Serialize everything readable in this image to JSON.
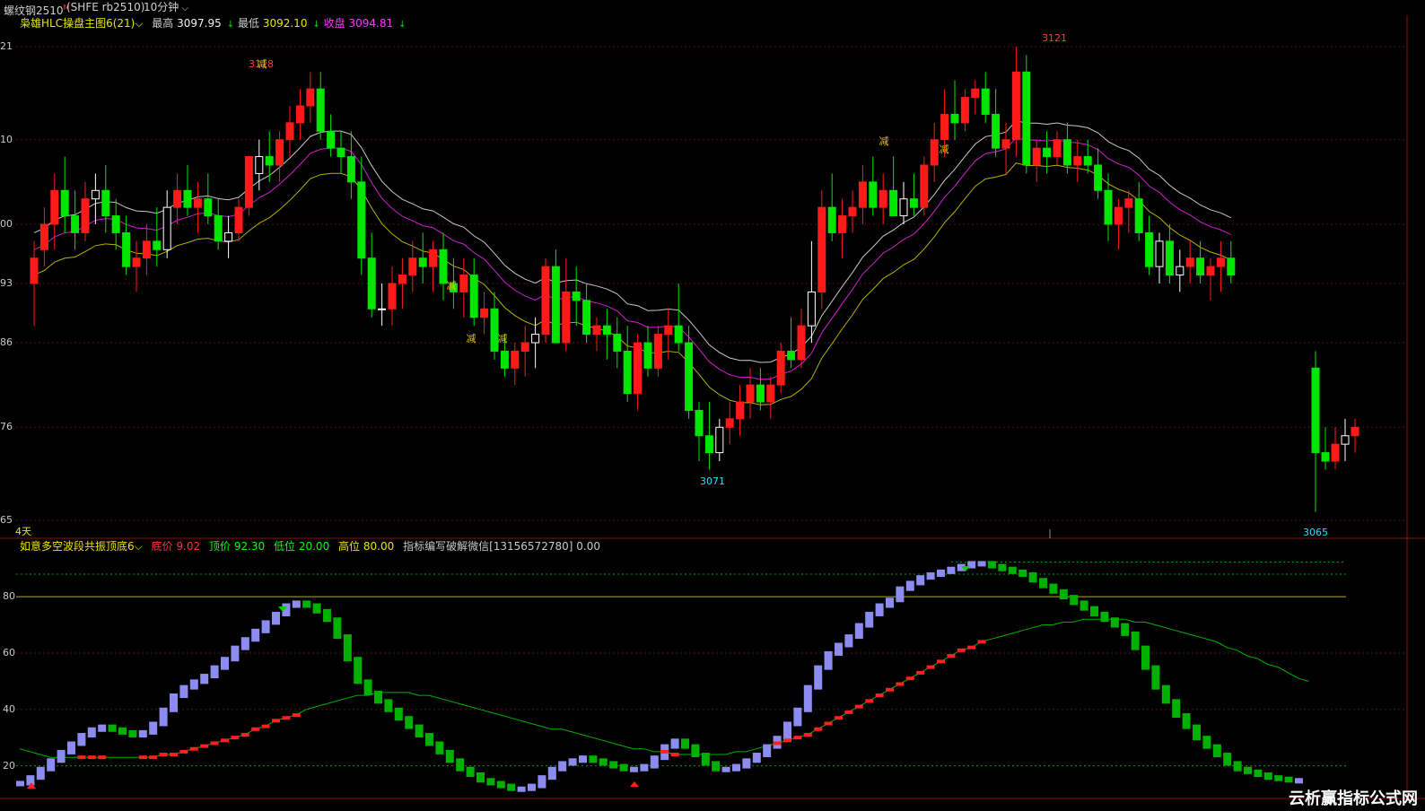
{
  "topbar": {
    "symbol": "螺纹钢2510",
    "symbol_sup": "M",
    "code": "(SHFE  rb2510)",
    "period": "10分钟"
  },
  "main_legend": {
    "indicator": "枭雄HLC操盘主图6(21)",
    "high_label": "最高",
    "high_value": "3097.95",
    "low_label": "最低",
    "low_value": "3092.10",
    "close_label": "收盘",
    "close_value": "3094.81"
  },
  "sub_legend": {
    "indicator": "如意多空波段共振顶底6",
    "bottom_label": "底价",
    "bottom_value": "9.02",
    "top_label": "顶价",
    "top_value": "92.30",
    "low_label": "低位",
    "low_value": "20.00",
    "high_label": "高位",
    "high_value": "80.00",
    "author_text": "指标编写破解微信[13156572780]",
    "author_value": "0.00"
  },
  "main_axis_labels": [
    "21",
    "10",
    "00",
    "93",
    "86",
    "76",
    "65"
  ],
  "sub_axis_labels": [
    "80",
    "60",
    "40",
    "20"
  ],
  "day_marker": "4天",
  "peak_labels": [
    "3118",
    "3121"
  ],
  "trough_labels": [
    "3071",
    "3065"
  ],
  "signal_char": "减",
  "watermark": "云析赢指标公式网",
  "colors": {
    "up": "#ff1a1a",
    "down": "#00e600",
    "doji": "#ffffff",
    "ma_white": "#c8c8c8",
    "ma_magenta": "#d020d0",
    "ma_yellow": "#b8b000",
    "osc_blue": "#8c8cf0",
    "osc_green": "#00b000",
    "osc_red": "#ff2020",
    "grid": "#5a1010"
  },
  "chart_data": [
    {
      "type": "candlestick",
      "title": "螺纹钢2510 10分钟",
      "ylim": [
        3065,
        3121
      ],
      "annotations": {
        "max": 3121,
        "min": 3065,
        "local_high": 3118,
        "local_low": 3071
      },
      "series": [
        {
          "name": "price",
          "values": [
            [
              3093,
              3098,
              3088,
              3096
            ],
            [
              3097,
              3102,
              3095,
              3100
            ],
            [
              3100,
              3106,
              3097,
              3104
            ],
            [
              3104,
              3108,
              3099,
              3101
            ],
            [
              3101,
              3104,
              3097,
              3099
            ],
            [
              3099,
              3105,
              3098,
              3103
            ],
            [
              3103,
              3106,
              3100,
              3104
            ],
            [
              3104,
              3107,
              3099,
              3101
            ],
            [
              3101,
              3103,
              3097,
              3099
            ],
            [
              3099,
              3101,
              3094,
              3095
            ],
            [
              3095,
              3098,
              3092,
              3096
            ],
            [
              3096,
              3100,
              3094,
              3098
            ],
            [
              3098,
              3102,
              3095,
              3097
            ],
            [
              3097,
              3104,
              3096,
              3102
            ],
            [
              3102,
              3106,
              3100,
              3104
            ],
            [
              3104,
              3107,
              3101,
              3102
            ],
            [
              3102,
              3105,
              3099,
              3103
            ],
            [
              3103,
              3106,
              3100,
              3101
            ],
            [
              3101,
              3103,
              3097,
              3098
            ],
            [
              3098,
              3101,
              3096,
              3099
            ],
            [
              3099,
              3103,
              3098,
              3102
            ],
            [
              3102,
              3106,
              3101,
              3108
            ],
            [
              3106,
              3110,
              3104,
              3108
            ],
            [
              3108,
              3111,
              3105,
              3107
            ],
            [
              3107,
              3111,
              3105,
              3110
            ],
            [
              3110,
              3114,
              3108,
              3112
            ],
            [
              3112,
              3116,
              3110,
              3114
            ],
            [
              3114,
              3118,
              3112,
              3116
            ],
            [
              3116,
              3118,
              3110,
              3111
            ],
            [
              3111,
              3113,
              3108,
              3109
            ],
            [
              3109,
              3111,
              3106,
              3108
            ],
            [
              3108,
              3111,
              3103,
              3105
            ],
            [
              3105,
              3108,
              3094,
              3096
            ],
            [
              3096,
              3099,
              3089,
              3090
            ],
            [
              3090,
              3093,
              3088,
              3090
            ],
            [
              3090,
              3095,
              3088,
              3093
            ],
            [
              3093,
              3096,
              3090,
              3094
            ],
            [
              3094,
              3098,
              3092,
              3096
            ],
            [
              3096,
              3099,
              3093,
              3095
            ],
            [
              3095,
              3098,
              3092,
              3097
            ],
            [
              3097,
              3099,
              3091,
              3093
            ],
            [
              3093,
              3096,
              3090,
              3092
            ],
            [
              3092,
              3096,
              3089,
              3094
            ],
            [
              3094,
              3096,
              3088,
              3089
            ],
            [
              3089,
              3092,
              3087,
              3090
            ],
            [
              3090,
              3092,
              3084,
              3085
            ],
            [
              3085,
              3087,
              3082,
              3083
            ],
            [
              3083,
              3086,
              3081,
              3085
            ],
            [
              3085,
              3088,
              3082,
              3086
            ],
            [
              3086,
              3089,
              3083,
              3087
            ],
            [
              3087,
              3096,
              3086,
              3095
            ],
            [
              3095,
              3097,
              3087,
              3086
            ],
            [
              3086,
              3096,
              3085,
              3092
            ],
            [
              3092,
              3095,
              3088,
              3091
            ],
            [
              3091,
              3093,
              3086,
              3087
            ],
            [
              3087,
              3089,
              3085,
              3088
            ],
            [
              3088,
              3090,
              3084,
              3087
            ],
            [
              3087,
              3089,
              3083,
              3085
            ],
            [
              3085,
              3088,
              3079,
              3080
            ],
            [
              3080,
              3087,
              3078,
              3086
            ],
            [
              3086,
              3088,
              3082,
              3083
            ],
            [
              3083,
              3088,
              3082,
              3087
            ],
            [
              3087,
              3090,
              3084,
              3088
            ],
            [
              3088,
              3093,
              3085,
              3086
            ],
            [
              3086,
              3088,
              3077,
              3078
            ],
            [
              3078,
              3079,
              3072,
              3075
            ],
            [
              3075,
              3079,
              3071,
              3073
            ],
            [
              3073,
              3077,
              3072,
              3076
            ],
            [
              3076,
              3079,
              3074,
              3077
            ],
            [
              3077,
              3081,
              3075,
              3079
            ],
            [
              3079,
              3083,
              3077,
              3081
            ],
            [
              3081,
              3083,
              3078,
              3079
            ],
            [
              3079,
              3082,
              3077,
              3081
            ],
            [
              3081,
              3086,
              3080,
              3085
            ],
            [
              3085,
              3089,
              3083,
              3084
            ],
            [
              3084,
              3090,
              3083,
              3088
            ],
            [
              3088,
              3098,
              3086,
              3092
            ],
            [
              3092,
              3104,
              3090,
              3102
            ],
            [
              3102,
              3106,
              3098,
              3099
            ],
            [
              3099,
              3103,
              3096,
              3101
            ],
            [
              3101,
              3104,
              3099,
              3102
            ],
            [
              3102,
              3107,
              3100,
              3105
            ],
            [
              3105,
              3108,
              3101,
              3102
            ],
            [
              3102,
              3106,
              3100,
              3104
            ],
            [
              3104,
              3108,
              3102,
              3101
            ],
            [
              3101,
              3105,
              3100,
              3103
            ],
            [
              3103,
              3106,
              3101,
              3102
            ],
            [
              3102,
              3108,
              3101,
              3107
            ],
            [
              3107,
              3112,
              3105,
              3110
            ],
            [
              3110,
              3116,
              3108,
              3113
            ],
            [
              3113,
              3117,
              3110,
              3112
            ],
            [
              3112,
              3116,
              3111,
              3115
            ],
            [
              3115,
              3117,
              3113,
              3116
            ],
            [
              3116,
              3118,
              3112,
              3113
            ],
            [
              3113,
              3116,
              3108,
              3109
            ],
            [
              3109,
              3112,
              3106,
              3110
            ],
            [
              3110,
              3121,
              3108,
              3118
            ],
            [
              3118,
              3120,
              3106,
              3107
            ],
            [
              3107,
              3110,
              3105,
              3109
            ],
            [
              3109,
              3111,
              3106,
              3108
            ],
            [
              3108,
              3111,
              3107,
              3110
            ],
            [
              3110,
              3112,
              3106,
              3107
            ],
            [
              3107,
              3110,
              3105,
              3108
            ],
            [
              3108,
              3110,
              3106,
              3107
            ],
            [
              3107,
              3109,
              3103,
              3104
            ],
            [
              3104,
              3106,
              3098,
              3100
            ],
            [
              3100,
              3103,
              3097,
              3102
            ],
            [
              3102,
              3104,
              3099,
              3103
            ],
            [
              3103,
              3105,
              3098,
              3099
            ],
            [
              3099,
              3101,
              3094,
              3095
            ],
            [
              3095,
              3099,
              3093,
              3098
            ],
            [
              3098,
              3100,
              3093,
              3094
            ],
            [
              3094,
              3097,
              3092,
              3095
            ],
            [
              3095,
              3098,
              3093,
              3096
            ],
            [
              3096,
              3098,
              3093,
              3094
            ],
            [
              3094,
              3096,
              3091,
              3095
            ],
            [
              3095,
              3098,
              3092,
              3096
            ],
            [
              3096,
              3098,
              3093,
              3094
            ],
            [
              3083,
              3085,
              3066,
              3073
            ],
            [
              3073,
              3076,
              3071,
              3072
            ],
            [
              3072,
              3076,
              3071,
              3074
            ],
            [
              3074,
              3077,
              3072,
              3075
            ],
            [
              3075,
              3077,
              3073,
              3076
            ]
          ]
        },
        {
          "name": "ma_white"
        },
        {
          "name": "ma_magenta"
        },
        {
          "name": "ma_yellow"
        }
      ]
    },
    {
      "type": "line",
      "title": "如意多空波段共振顶底6",
      "ylim": [
        10,
        95
      ],
      "reference_lines": [
        20,
        80,
        88,
        92.3
      ],
      "series": [
        {
          "name": "osc",
          "values": [
            14,
            16,
            19,
            22,
            25,
            28,
            31,
            33,
            34,
            33,
            32,
            31,
            32,
            35,
            40,
            45,
            48,
            50,
            52,
            55,
            58,
            62,
            65,
            68,
            71,
            74,
            77,
            78,
            77,
            75,
            72,
            66,
            58,
            50,
            46,
            43,
            40,
            37,
            34,
            31,
            28,
            25,
            22,
            19,
            17,
            15,
            14,
            13,
            12,
            12,
            13,
            16,
            19,
            21,
            22,
            23,
            22,
            21,
            20,
            19,
            19,
            20,
            23,
            27,
            29,
            27,
            24,
            21,
            19,
            19,
            20,
            22,
            24,
            27,
            30,
            35,
            40,
            48,
            55,
            60,
            63,
            66,
            70,
            74,
            77,
            79,
            83,
            85,
            87,
            88,
            89,
            90,
            91,
            92,
            92,
            91,
            90,
            89,
            88,
            86,
            84,
            82,
            80,
            78,
            76,
            74,
            72,
            70,
            67,
            62,
            55,
            48,
            43,
            38,
            34,
            30,
            27,
            24,
            21,
            19,
            18,
            17,
            16,
            15.5,
            15,
            15
          ]
        },
        {
          "name": "ma_slow",
          "values": [
            26,
            25,
            24,
            23,
            23,
            23,
            23,
            23,
            23,
            23,
            23,
            23,
            23,
            23,
            24,
            24,
            25,
            26,
            27,
            28,
            29,
            30,
            31,
            33,
            34,
            36,
            37,
            38,
            40,
            41,
            42,
            43,
            44,
            45,
            45,
            46,
            46,
            46,
            46,
            45,
            45,
            44,
            43,
            42,
            41,
            40,
            39,
            38,
            37,
            36,
            35,
            34,
            33,
            33,
            32,
            31,
            30,
            29,
            28,
            27,
            26,
            26,
            25,
            25,
            24,
            24,
            24,
            24,
            24,
            24,
            25,
            25,
            26,
            27,
            28,
            29,
            30,
            31,
            33,
            35,
            37,
            39,
            41,
            43,
            45,
            47,
            49,
            51,
            53,
            55,
            57,
            59,
            61,
            62,
            64,
            65,
            66,
            67,
            68,
            69,
            70,
            70,
            71,
            71,
            72,
            72,
            72,
            72,
            72,
            71,
            71,
            70,
            69,
            68,
            67,
            66,
            65,
            64,
            62,
            61,
            59,
            58,
            56,
            55,
            53,
            51,
            50
          ]
        }
      ]
    }
  ]
}
